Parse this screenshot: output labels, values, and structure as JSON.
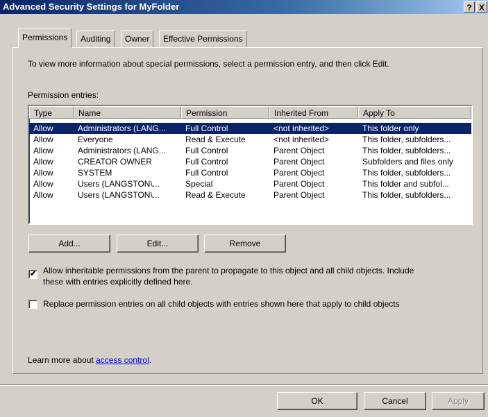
{
  "window": {
    "title": "Advanced Security Settings for MyFolder",
    "help_btn": "?",
    "close_btn": "X"
  },
  "tabs": [
    {
      "label": "Permissions",
      "active": true
    },
    {
      "label": "Auditing"
    },
    {
      "label": "Owner"
    },
    {
      "label": "Effective Permissions"
    }
  ],
  "instructions": "To view more information about special permissions, select a permission entry, and then click Edit.",
  "entries_label": "Permission entries:",
  "columns": [
    "Type",
    "Name",
    "Permission",
    "Inherited From",
    "Apply To"
  ],
  "rows": [
    {
      "type": "Allow",
      "name": "Administrators (LANG...",
      "permission": "Full Control",
      "inherited": "<not inherited>",
      "apply": "This folder only",
      "selected": true
    },
    {
      "type": "Allow",
      "name": "Everyone",
      "permission": "Read & Execute",
      "inherited": "<not inherited>",
      "apply": "This folder, subfolders..."
    },
    {
      "type": "Allow",
      "name": "Administrators (LANG...",
      "permission": "Full Control",
      "inherited": "Parent Object",
      "apply": "This folder, subfolders..."
    },
    {
      "type": "Allow",
      "name": "CREATOR OWNER",
      "permission": "Full Control",
      "inherited": "Parent Object",
      "apply": "Subfolders and files only"
    },
    {
      "type": "Allow",
      "name": "SYSTEM",
      "permission": "Full Control",
      "inherited": "Parent Object",
      "apply": "This folder, subfolders..."
    },
    {
      "type": "Allow",
      "name": "Users (LANGSTON\\...",
      "permission": "Special",
      "inherited": "Parent Object",
      "apply": "This folder and subfol..."
    },
    {
      "type": "Allow",
      "name": "Users (LANGSTON\\...",
      "permission": "Read & Execute",
      "inherited": "Parent Object",
      "apply": "This folder, subfolders..."
    }
  ],
  "buttons": {
    "add": "Add...",
    "edit": "Edit...",
    "remove": "Remove",
    "ok": "OK",
    "cancel": "Cancel",
    "apply": "Apply"
  },
  "checkbox_inherit": {
    "checked": true,
    "mark": "✔",
    "line1": "Allow inheritable permissions from the parent to propagate to this object and all child objects. Include",
    "line2": "these with entries explicitly defined here."
  },
  "checkbox_replace": {
    "checked": false,
    "label": "Replace permission entries on all child objects with entries shown here that apply to child objects"
  },
  "learn_more": {
    "prefix": "Learn more about ",
    "link": "access control",
    "suffix": "."
  }
}
